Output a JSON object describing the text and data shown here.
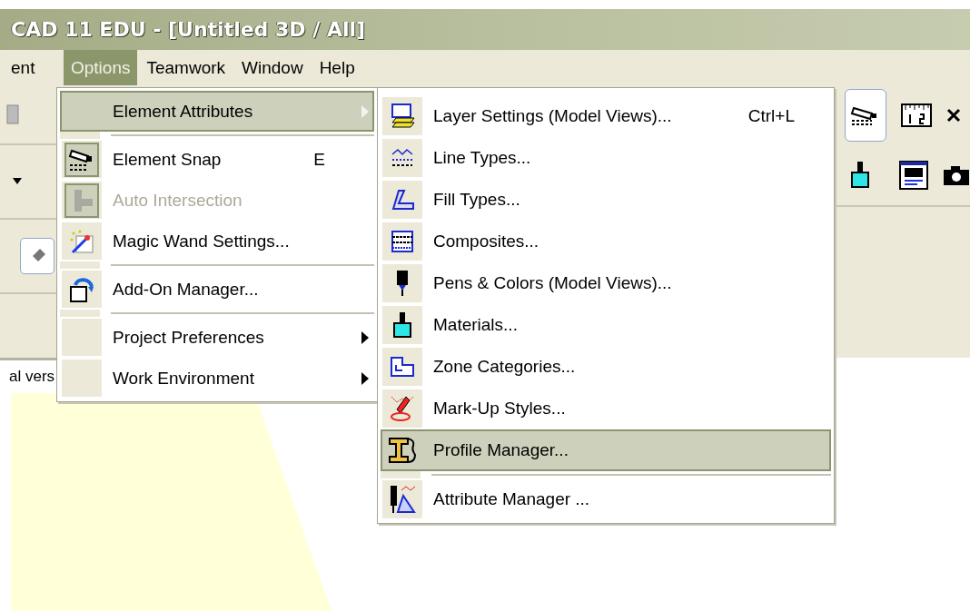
{
  "window": {
    "title": "CAD 11 EDU - [Untitled 3D / All]"
  },
  "menu_bar": [
    {
      "label": "ent",
      "selected": false
    },
    {
      "label": "Options",
      "selected": true
    },
    {
      "label": "Teamwork",
      "selected": false
    },
    {
      "label": "Window",
      "selected": false
    },
    {
      "label": "Help",
      "selected": false
    }
  ],
  "options_menu": {
    "items": [
      {
        "kind": "item",
        "label": "Element Attributes",
        "selected": true,
        "checked": false,
        "disabled": false,
        "has_submenu": true
      },
      {
        "kind": "separator"
      },
      {
        "kind": "item",
        "label": "Element Snap",
        "shortcut": "E",
        "selected": false,
        "checked": true,
        "disabled": false,
        "has_submenu": false
      },
      {
        "kind": "item",
        "label": "Auto Intersection",
        "selected": false,
        "checked": true,
        "disabled": true,
        "has_submenu": false
      },
      {
        "kind": "item",
        "label": "Magic Wand Settings...",
        "selected": false,
        "checked": false,
        "disabled": false,
        "has_submenu": false
      },
      {
        "kind": "separator"
      },
      {
        "kind": "item",
        "label": "Add-On Manager...",
        "selected": false,
        "checked": false,
        "disabled": false,
        "has_submenu": false
      },
      {
        "kind": "separator"
      },
      {
        "kind": "item",
        "label": "Project Preferences",
        "selected": false,
        "checked": false,
        "disabled": false,
        "has_submenu": true
      },
      {
        "kind": "item",
        "label": "Work Environment",
        "selected": false,
        "checked": false,
        "disabled": false,
        "has_submenu": true
      }
    ]
  },
  "element_attributes_submenu": {
    "items": [
      {
        "kind": "item",
        "label": "Layer Settings (Model Views)...",
        "shortcut": "Ctrl+L",
        "selected": false
      },
      {
        "kind": "item",
        "label": "Line Types...",
        "selected": false
      },
      {
        "kind": "item",
        "label": "Fill Types...",
        "selected": false
      },
      {
        "kind": "item",
        "label": "Composites...",
        "selected": false
      },
      {
        "kind": "item",
        "label": "Pens & Colors (Model Views)...",
        "selected": false
      },
      {
        "kind": "item",
        "label": "Materials...",
        "selected": false
      },
      {
        "kind": "item",
        "label": "Zone Categories...",
        "selected": false
      },
      {
        "kind": "item",
        "label": "Mark-Up Styles...",
        "selected": false
      },
      {
        "kind": "item",
        "label": "Profile Manager...",
        "selected": true
      },
      {
        "kind": "separator"
      },
      {
        "kind": "item",
        "label": "Attribute Manager ...",
        "selected": false
      }
    ]
  },
  "status_text": "al vers"
}
